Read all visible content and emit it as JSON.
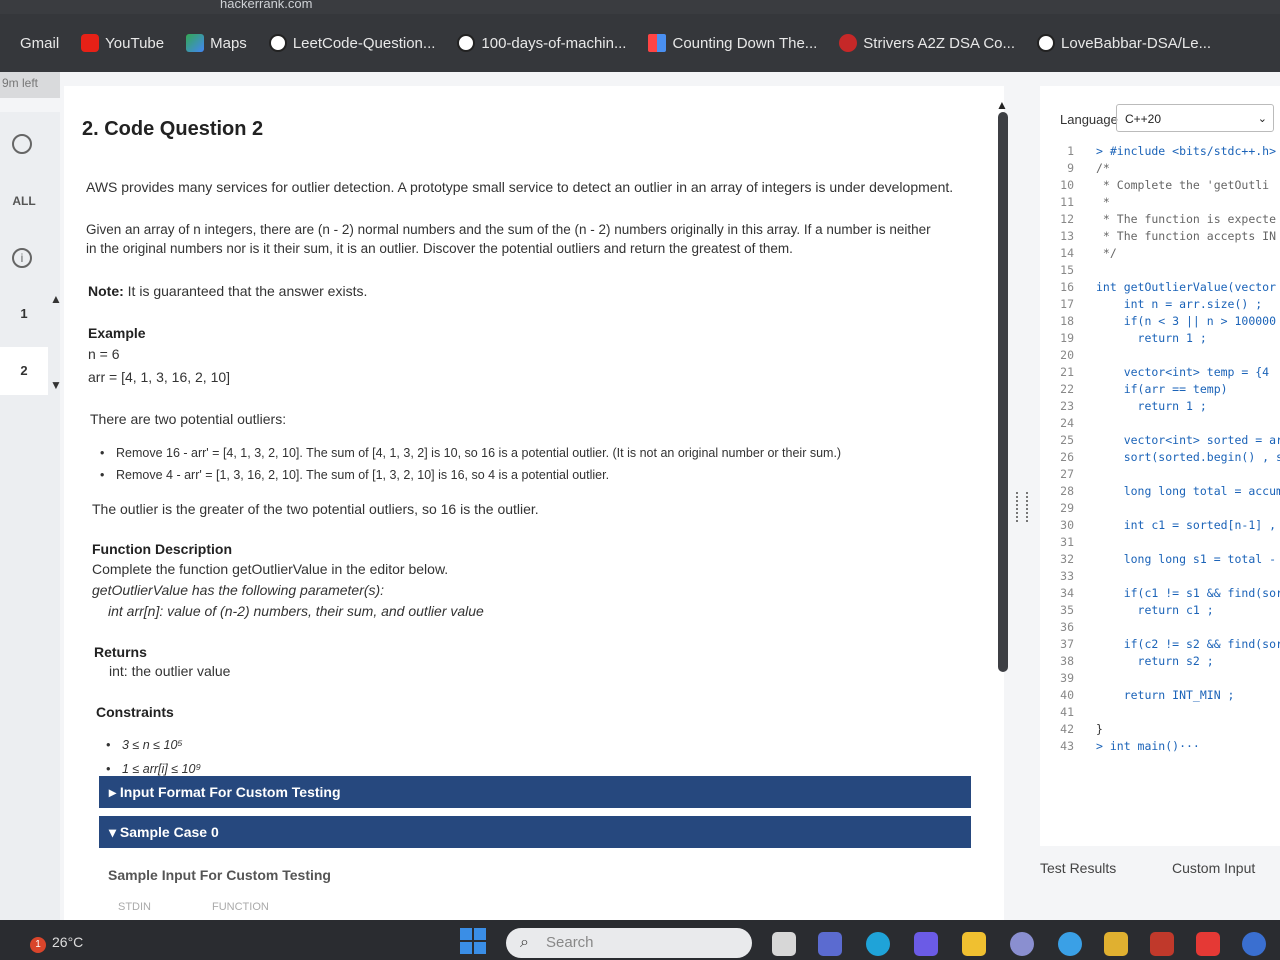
{
  "browser": {
    "url": "hackerrank.com",
    "bookmarks": [
      {
        "label": "Gmail",
        "icon": "gmail-icon"
      },
      {
        "label": "YouTube",
        "icon": "youtube-icon"
      },
      {
        "label": "Maps",
        "icon": "maps-icon"
      },
      {
        "label": "LeetCode-Question...",
        "icon": "github-icon"
      },
      {
        "label": "100-days-of-machin...",
        "icon": "github-icon"
      },
      {
        "label": "Counting Down The...",
        "icon": "calendar-icon"
      },
      {
        "label": "Strivers A2Z DSA Co...",
        "icon": "tuf-icon"
      },
      {
        "label": "LoveBabbar-DSA/Le...",
        "icon": "github-icon"
      }
    ]
  },
  "sidebar": {
    "timer": "9m left",
    "all_label": "ALL",
    "questions": [
      "1",
      "2"
    ]
  },
  "problem": {
    "title": "2. Code Question 2",
    "intro": "AWS provides many services for outlier detection. A prototype small service to detect an outlier in an array of integers is under development.",
    "given_1": "Given an array of n integers, there are (n - 2) normal numbers and the sum of the (n - 2) numbers originally in this array. If a number is neither",
    "given_2": "in the original numbers nor is it their sum, it is an outlier. Discover the potential outliers and return the greatest of them.",
    "note_label": "Note:",
    "note_text": "It is guaranteed that the answer exists.",
    "example_heading": "Example",
    "example_n": "n = 6",
    "example_arr": "arr = [4, 1, 3, 16, 2, 10]",
    "two_outliers": "There are two potential outliers:",
    "bullet_1": "Remove 16 - arr' = [4, 1, 3, 2, 10]. The sum of [4, 1, 3, 2] is 10, so 16 is a potential outlier. (It is not an original number or their sum.)",
    "bullet_2": "Remove 4 - arr' = [1, 3, 16, 2, 10]. The sum of [1, 3, 2, 10] is 16, so 4 is a potential outlier.",
    "conclusion": "The outlier is the greater of the two potential outliers, so 16 is the outlier.",
    "func_heading": "Function Description",
    "func_1": "Complete the function getOutlierValue in the editor below.",
    "func_2": "getOutlierValue has the following parameter(s):",
    "func_3": "int arr[n]:  value of (n-2) numbers, their sum, and outlier value",
    "returns_heading": "Returns",
    "returns_text": "int: the outlier value",
    "constraints_heading": "Constraints",
    "constraint_1": "3 ≤ n ≤ 10⁵",
    "constraint_2": "1 ≤ arr[i] ≤ 10⁹",
    "input_format": "▸ Input Format For Custom Testing",
    "sample_case": "▾ Sample Case 0",
    "sample_input": "Sample Input For Custom Testing",
    "stdin": "STDIN",
    "function": "FUNCTION"
  },
  "editor": {
    "language_label": "Language",
    "language": "C++20",
    "lines": [
      {
        "n": "1",
        "code": "> #include <bits/stdc++.h>"
      },
      {
        "n": "9",
        "code": "/*"
      },
      {
        "n": "10",
        "code": " * Complete the 'getOutli"
      },
      {
        "n": "11",
        "code": " *"
      },
      {
        "n": "12",
        "code": " * The function is expecte"
      },
      {
        "n": "13",
        "code": " * The function accepts IN"
      },
      {
        "n": "14",
        "code": " */"
      },
      {
        "n": "15",
        "code": ""
      },
      {
        "n": "16",
        "code": "int getOutlierValue(vector"
      },
      {
        "n": "17",
        "code": "    int n = arr.size() ;"
      },
      {
        "n": "18",
        "code": "    if(n < 3 || n > 100000"
      },
      {
        "n": "19",
        "code": "      return 1 ;"
      },
      {
        "n": "20",
        "code": ""
      },
      {
        "n": "21",
        "code": "    vector<int> temp = {4"
      },
      {
        "n": "22",
        "code": "    if(arr == temp)"
      },
      {
        "n": "23",
        "code": "      return 1 ;"
      },
      {
        "n": "24",
        "code": ""
      },
      {
        "n": "25",
        "code": "    vector<int> sorted = ar"
      },
      {
        "n": "26",
        "code": "    sort(sorted.begin() , s"
      },
      {
        "n": "27",
        "code": ""
      },
      {
        "n": "28",
        "code": "    long long total = accum"
      },
      {
        "n": "29",
        "code": ""
      },
      {
        "n": "30",
        "code": "    int c1 = sorted[n-1] ,"
      },
      {
        "n": "31",
        "code": ""
      },
      {
        "n": "32",
        "code": "    long long s1 = total - "
      },
      {
        "n": "33",
        "code": ""
      },
      {
        "n": "34",
        "code": "    if(c1 != s1 && find(sort"
      },
      {
        "n": "35",
        "code": "      return c1 ;"
      },
      {
        "n": "36",
        "code": ""
      },
      {
        "n": "37",
        "code": "    if(c2 != s2 && find(sort"
      },
      {
        "n": "38",
        "code": "      return s2 ;"
      },
      {
        "n": "39",
        "code": ""
      },
      {
        "n": "40",
        "code": "    return INT_MIN ;"
      },
      {
        "n": "41",
        "code": ""
      },
      {
        "n": "42",
        "code": "}"
      },
      {
        "n": "43",
        "code": "> int main()···"
      }
    ],
    "test_results": "Test Results",
    "custom_input": "Custom Input"
  },
  "taskbar": {
    "notification_count": "1",
    "temperature": "26°C",
    "search_placeholder": "Search"
  }
}
